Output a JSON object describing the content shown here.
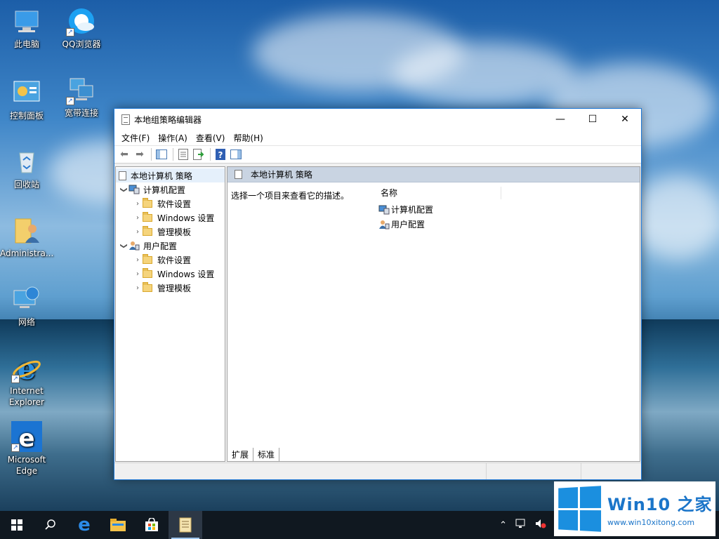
{
  "desktop": {
    "icons": [
      {
        "label": "此电脑"
      },
      {
        "label": "QQ浏览器"
      },
      {
        "label": "控制面板"
      },
      {
        "label": "宽带连接"
      },
      {
        "label": "回收站"
      },
      {
        "label": "Administra..."
      },
      {
        "label": "网络"
      },
      {
        "label": "Internet Explorer"
      },
      {
        "label": "Microsoft Edge"
      }
    ]
  },
  "window": {
    "title": "本地组策略编辑器",
    "menu": [
      "文件(F)",
      "操作(A)",
      "查看(V)",
      "帮助(H)"
    ],
    "tree": {
      "root": "本地计算机 策略",
      "computer": "计算机配置",
      "user": "用户配置",
      "children": [
        "软件设置",
        "Windows 设置",
        "管理模板"
      ]
    },
    "right_pane": {
      "header": "本地计算机 策略",
      "description": "选择一个项目来查看它的描述。",
      "column_name": "名称",
      "items": [
        "计算机配置",
        "用户配置"
      ]
    },
    "tabs": [
      "扩展",
      "标准"
    ]
  },
  "taskbar": {
    "apps": [
      "start-icon",
      "search-icon",
      "edge-icon",
      "file-explorer-icon",
      "store-icon",
      "gpedit-icon"
    ]
  },
  "watermark": {
    "title": "Win10 之家",
    "url": "www.win10xitong.com"
  }
}
